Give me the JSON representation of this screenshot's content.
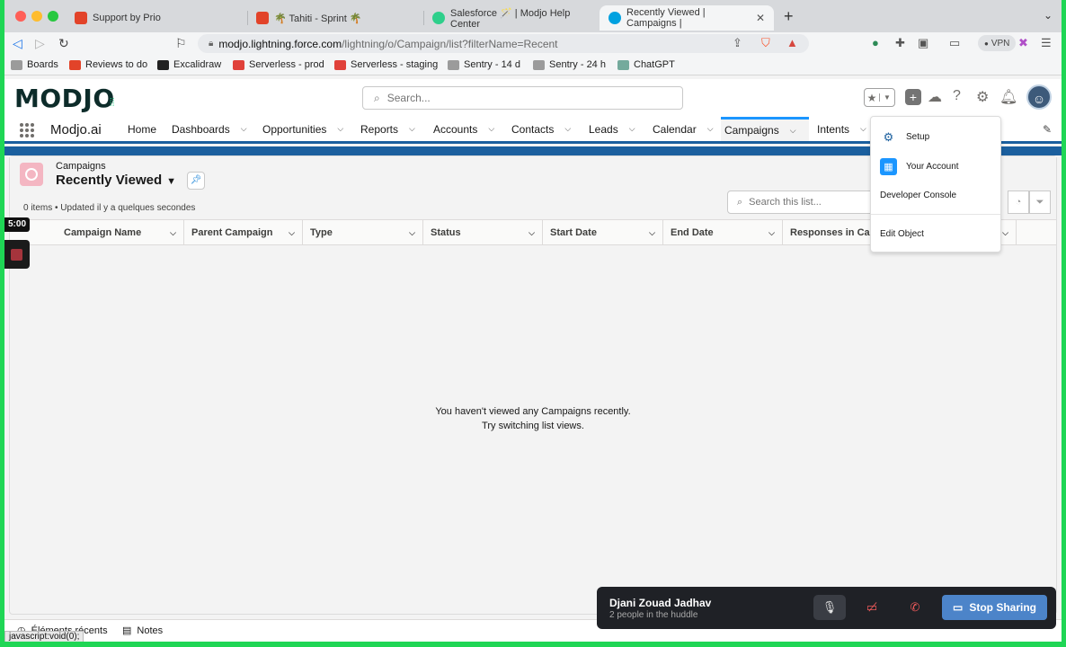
{
  "browser": {
    "tabs": [
      {
        "title": "Support by Prio",
        "favicon": "gitlab-icon",
        "color": "#e24329"
      },
      {
        "title": "🌴 Tahiti - Sprint 🌴",
        "favicon": "gitlab-icon",
        "color": "#e24329"
      },
      {
        "title": "Salesforce 🪄 | Modjo Help Center",
        "favicon": "modjo-icon",
        "color": "#2ecf8b"
      },
      {
        "title": "Recently Viewed | Campaigns |",
        "favicon": "salesforce-cloud-icon",
        "color": "#00a1e0"
      }
    ],
    "url_host": "modjo.lightning.force.com",
    "url_path": "/lightning/o/Campaign/list?filterName=Recent",
    "vpn_label": "VPN",
    "bookmarks": [
      {
        "label": "Boards",
        "icon": "folder-icon",
        "color": "#9b9b9b"
      },
      {
        "label": "Reviews to do",
        "icon": "gitlab-icon",
        "color": "#e24329"
      },
      {
        "label": "Excalidraw",
        "icon": "excalidraw-icon",
        "color": "#222222"
      },
      {
        "label": "Serverless - prod",
        "icon": "serverless-icon",
        "color": "#e0413a"
      },
      {
        "label": "Serverless - staging",
        "icon": "serverless-icon",
        "color": "#e0413a"
      },
      {
        "label": "Sentry - 14 d",
        "icon": "folder-icon",
        "color": "#9b9b9b"
      },
      {
        "label": "Sentry - 24 h",
        "icon": "folder-icon",
        "color": "#9b9b9b"
      },
      {
        "label": "ChatGPT",
        "icon": "chatgpt-icon",
        "color": "#74aa9c"
      }
    ]
  },
  "header": {
    "logo": "MODJO",
    "search_placeholder": "Search..."
  },
  "nav": {
    "app_name": "Modjo.ai",
    "items": [
      {
        "label": "Home",
        "dropdown": false
      },
      {
        "label": "Dashboards",
        "dropdown": true
      },
      {
        "label": "Opportunities",
        "dropdown": true
      },
      {
        "label": "Reports",
        "dropdown": true
      },
      {
        "label": "Accounts",
        "dropdown": true
      },
      {
        "label": "Contacts",
        "dropdown": true
      },
      {
        "label": "Leads",
        "dropdown": true
      },
      {
        "label": "Calendar",
        "dropdown": true
      },
      {
        "label": "Campaigns",
        "dropdown": true,
        "active": true
      },
      {
        "label": "Intents",
        "dropdown": true
      }
    ]
  },
  "list": {
    "object_label": "Campaigns",
    "view_title": "Recently Viewed",
    "meta": "0 items • Updated il y a quelques secondes",
    "search_placeholder": "Search this list...",
    "columns": [
      "Campaign Name",
      "Parent Campaign",
      "Type",
      "Status",
      "Start Date",
      "End Date",
      "Responses in Ca..."
    ],
    "empty_line1": "You haven't viewed any Campaigns recently.",
    "empty_line2": "Try switching list views."
  },
  "setup_menu": {
    "items": [
      {
        "label": "Setup",
        "icon": "gear-icon"
      },
      {
        "label": "Your Account",
        "icon": "account-icon"
      },
      {
        "label": "Developer Console"
      },
      {
        "label": "Edit Object"
      }
    ]
  },
  "recording": {
    "timer": "5:00"
  },
  "utility_bar": {
    "items": [
      "Éléments récents",
      "Notes"
    ],
    "status_link": "javascript:void(0);"
  },
  "huddle": {
    "name": "Djani Zouad Jadhav",
    "subtitle": "2 people in the huddle",
    "stop_label": "Stop Sharing"
  }
}
